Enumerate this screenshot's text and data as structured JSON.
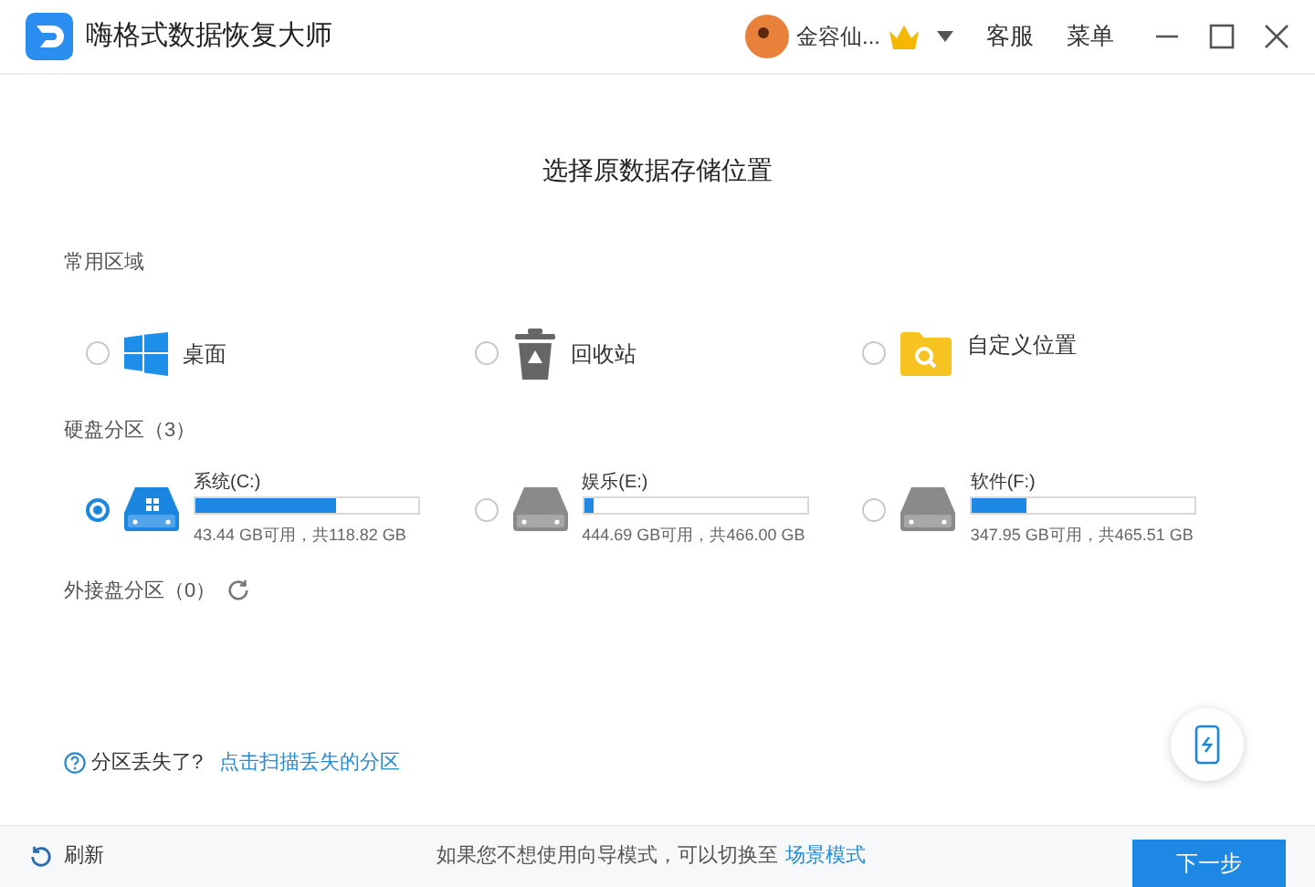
{
  "window": {
    "title": "嗨格式数据恢复大师",
    "user": "金容仙...",
    "menu": [
      "客服",
      "菜单"
    ]
  },
  "heading": "选择原数据存储位置",
  "common_section": {
    "title": "常用区域",
    "items": [
      {
        "kind": "desktop",
        "label": "桌面",
        "selected": false
      },
      {
        "kind": "recycle",
        "label": "回收站",
        "selected": false
      },
      {
        "kind": "custom",
        "label": "自定义位置",
        "selected": false
      }
    ]
  },
  "disk_section": {
    "title": "硬盘分区（3）",
    "drives": [
      {
        "name": "系统(C:)",
        "level": 0.63,
        "usage": "43.44 GB可用，共118.82 GB",
        "selected": true
      },
      {
        "name": "娱乐(E:)",
        "level": 0.04,
        "usage": "444.69 GB可用，共466.00 GB",
        "selected": false
      },
      {
        "name": "软件(F:)",
        "level": 0.24,
        "usage": "347.95 GB可用，共465.51 GB",
        "selected": false
      }
    ]
  },
  "external_section": {
    "title": "外接盘分区（0）"
  },
  "lost_partition": {
    "question": "分区丢失了?",
    "link": "点击扫描丢失的分区"
  },
  "footer": {
    "refresh": "刷新",
    "hint": "如果您不想使用向导模式，可以切换至",
    "mode_link": "场景模式",
    "next": "下一步"
  }
}
